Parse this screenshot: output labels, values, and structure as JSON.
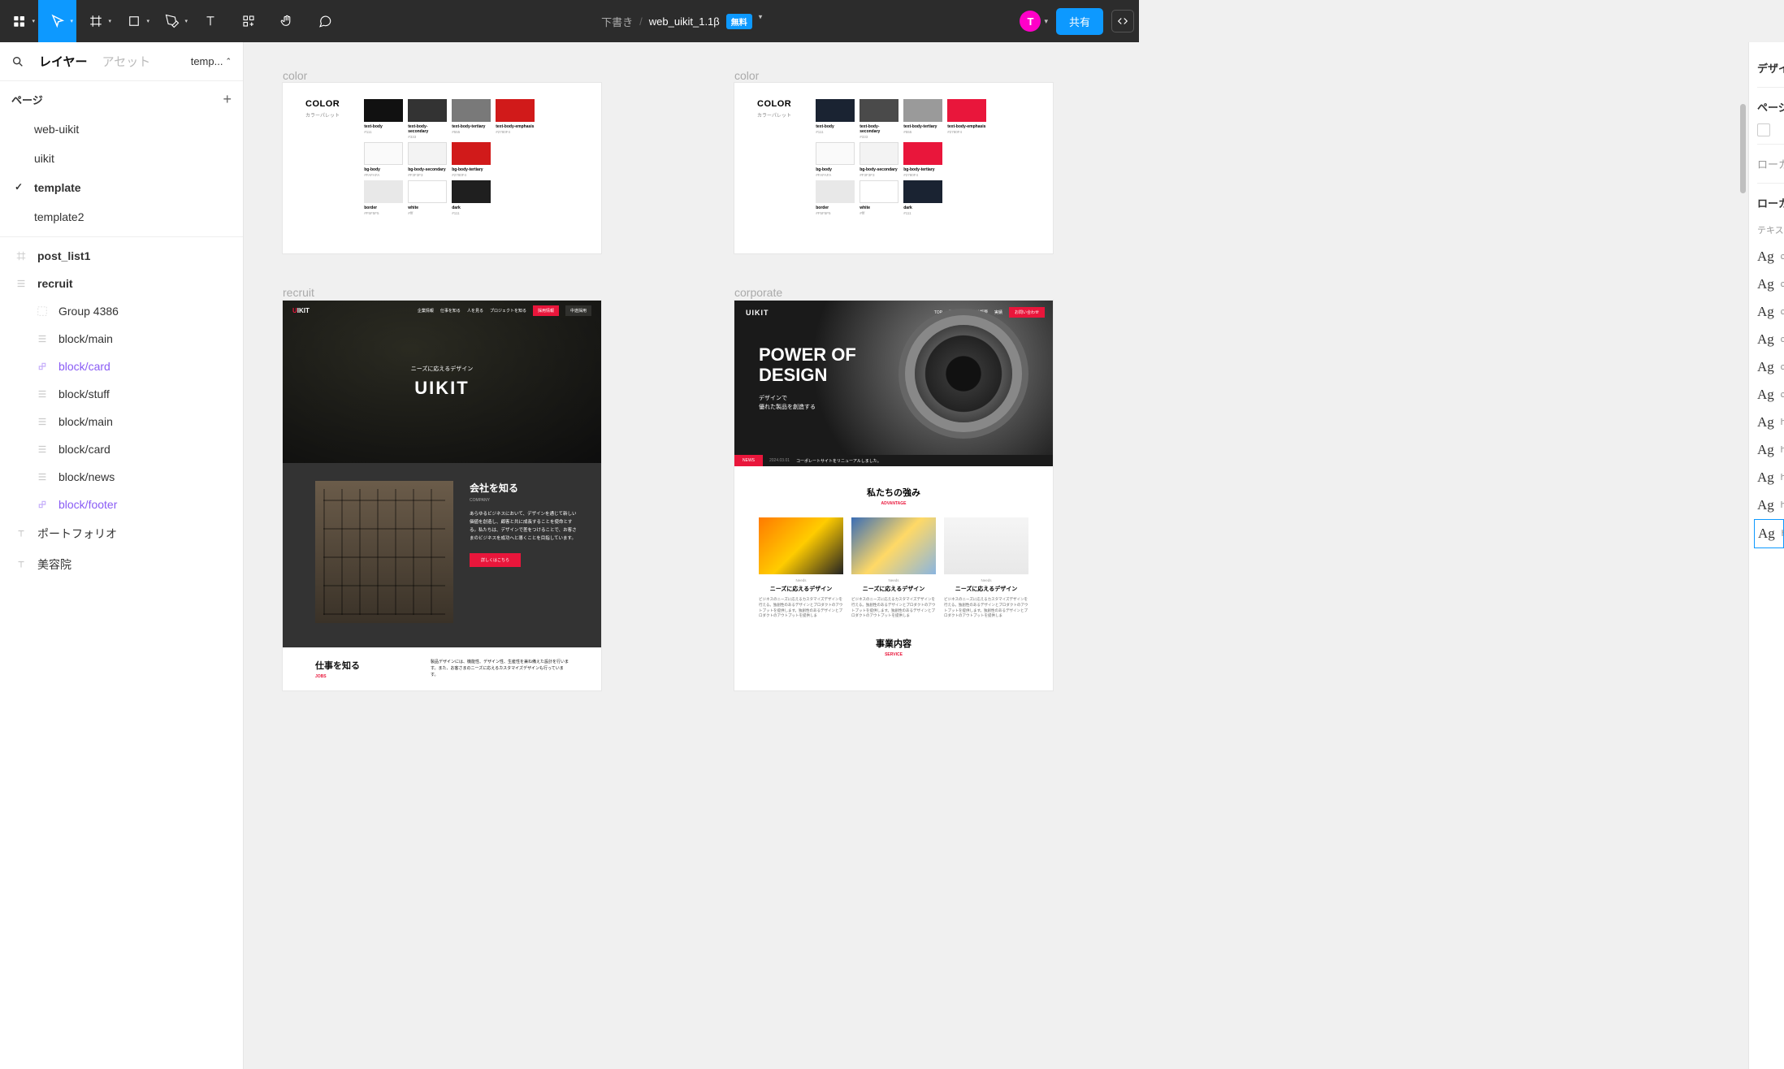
{
  "toolbar": {
    "title_draft": "下書き",
    "title_file": "web_uikit_1.1β",
    "badge_free": "無料",
    "share": "共有",
    "avatar": "T"
  },
  "left_panel": {
    "tab_layers": "レイヤー",
    "tab_assets": "アセット",
    "page_picker": "temp...",
    "pages_header": "ページ",
    "pages": [
      {
        "name": "web-uikit",
        "current": false
      },
      {
        "name": "uikit",
        "current": false
      },
      {
        "name": "template",
        "current": true
      },
      {
        "name": "template2",
        "current": false
      }
    ],
    "layers": [
      {
        "name": "post_list1",
        "icon": "frame",
        "level": 0,
        "bold": true
      },
      {
        "name": "recruit",
        "icon": "frame-lines",
        "level": 0,
        "bold": true
      },
      {
        "name": "Group 4386",
        "icon": "group",
        "level": 1
      },
      {
        "name": "block/main",
        "icon": "frame-lines",
        "level": 1
      },
      {
        "name": "block/card",
        "icon": "component",
        "level": 1,
        "comp": true
      },
      {
        "name": "block/stuff",
        "icon": "frame-lines",
        "level": 1
      },
      {
        "name": "block/main",
        "icon": "frame-lines",
        "level": 1
      },
      {
        "name": "block/card",
        "icon": "frame-lines",
        "level": 1
      },
      {
        "name": "block/news",
        "icon": "frame-lines",
        "level": 1
      },
      {
        "name": "block/footer",
        "icon": "component",
        "level": 1,
        "comp": true
      },
      {
        "name": "ポートフォリオ",
        "icon": "text",
        "level": 0
      },
      {
        "name": "美容院",
        "icon": "text",
        "level": 0
      }
    ]
  },
  "right_panel": {
    "design": "デザイ",
    "page": "ページ",
    "local": "ローカ",
    "local2": "ローカ",
    "text_styles": "テキス",
    "ag_items": [
      "Ag c",
      "Ag c",
      "Ag c",
      "Ag c",
      "Ag c",
      "Ag c",
      "Ag h",
      "Ag h",
      "Ag h",
      "Ag h",
      "Ag h"
    ]
  },
  "canvas": {
    "frames": {
      "color1": {
        "label": "color",
        "title": "COLOR",
        "subtitle": "カラーパレット",
        "swatches": [
          [
            {
              "color": "#111111",
              "name": "text-body",
              "hex": "#111"
            },
            {
              "color": "#333333",
              "name": "text-body-secondary",
              "hex": "#333"
            },
            {
              "color": "#797979",
              "name": "text-body-tertiary",
              "hex": "#555"
            },
            {
              "color": "#d11a1a",
              "name": "text-body-emphasis",
              "hex": "#2780F4"
            }
          ],
          [
            {
              "color": "#fafafa",
              "name": "bg-body",
              "hex": "#FAFAFA",
              "border": true
            },
            {
              "color": "#f3f3f3",
              "name": "bg-body-secondary",
              "hex": "#F3F3F3",
              "border": true
            },
            {
              "color": "#d11a1a",
              "name": "bg-body-tertiary",
              "hex": "#2780F4"
            }
          ],
          [
            {
              "color": "#e8e8e8",
              "name": "border",
              "hex": "#F5F5F5"
            },
            {
              "color": "#ffffff",
              "name": "white",
              "hex": "#fff",
              "border": true
            },
            {
              "color": "#1f1f1f",
              "name": "dark",
              "hex": "#111"
            }
          ]
        ]
      },
      "color2": {
        "label": "color",
        "title": "COLOR",
        "subtitle": "カラーパレット",
        "swatches": [
          [
            {
              "color": "#1a2332",
              "name": "text-body",
              "hex": "#111"
            },
            {
              "color": "#4a4a4a",
              "name": "text-body-secondary",
              "hex": "#333"
            },
            {
              "color": "#9a9a9a",
              "name": "text-body-tertiary",
              "hex": "#555"
            },
            {
              "color": "#e9163b",
              "name": "text-body-emphasis",
              "hex": "#2780F4"
            }
          ],
          [
            {
              "color": "#fafafa",
              "name": "bg-body",
              "hex": "#FAFAFA",
              "border": true
            },
            {
              "color": "#f3f3f3",
              "name": "bg-body-secondary",
              "hex": "#F3F3F3",
              "border": true
            },
            {
              "color": "#e9163b",
              "name": "bg-body-tertiary",
              "hex": "#2780F4"
            }
          ],
          [
            {
              "color": "#e8e8e8",
              "name": "border",
              "hex": "#F5F5F5"
            },
            {
              "color": "#ffffff",
              "name": "white",
              "hex": "#fff",
              "border": true
            },
            {
              "color": "#1a2332",
              "name": "dark",
              "hex": "#111"
            }
          ]
        ]
      },
      "recruit": {
        "label": "recruit",
        "logo": "IKIT",
        "nav": [
          "企業情報",
          "仕事を知る",
          "人を見る",
          "プロジェクトを知る"
        ],
        "nav_btn1": "採用情報",
        "nav_btn2": "中途採用",
        "hero_sub": "ニーズに応えるデザイン",
        "hero_title": "UIKIT",
        "company_h": "会社を知る",
        "company_en": "COMPANY",
        "company_p": "あらゆるビジネスにおいて、デザインを通じて新しい価値を創造し、顧客と共に成長することを使命とする。私たちは、デザインで差をつけることで、お客さまのビジネスを成功へと導くことを目指しています。",
        "company_cta": "詳しくはこちら",
        "jobs_h": "仕事を知る",
        "jobs_en": "JOBS",
        "jobs_p": "製品デザインには、機能性、デザイン性、生産性を兼ね備えた設計を行います。また、お客さまのニーズに応えるカスタマイズデザインも行っています。"
      },
      "corporate": {
        "label": "corporate",
        "logo": "UIKIT",
        "nav": [
          "TOP",
          "事業内容",
          "会社概要",
          "実績",
          "お問い合わせ"
        ],
        "hero_h1a": "POWER OF",
        "hero_h1b": "DESIGN",
        "hero_sub1": "デザインで",
        "hero_sub2": "優れた製品を創造する",
        "news_tag": "NEWS",
        "news_date": "2024.03.01",
        "news_text": "コーポレートサイトをリニューアルしました。",
        "adv_h": "私たちの強み",
        "adv_en": "ADVANTAGE",
        "cards": [
          {
            "sub": "Needs",
            "title": "ニーズに応えるデザイン",
            "desc": "ビジネスのニーズに応えるカスタマイズデザインを行える。独創性のあるデザインとプロダクトのアウトプットを提供します。独創性のあるデザインとプロダクトのアウトプットを提供しま"
          },
          {
            "sub": "Needs",
            "title": "ニーズに応えるデザイン",
            "desc": "ビジネスのニーズに応えるカスタマイズデザインを行える。独創性のあるデザインとプロダクトのアウトプットを提供します。独創性のあるデザインとプロダクトのアウトプットを提供しま"
          },
          {
            "sub": "Needs",
            "title": "ニーズに応えるデザイン",
            "desc": "ビジネスのニーズに応えるカスタマイズデザインを行える。独創性のあるデザインとプロダクトのアウトプットを提供します。独創性のあるデザインとプロダクトのアウトプットを提供しま"
          }
        ],
        "service_h": "事業内容",
        "service_en": "SERVICE"
      }
    }
  }
}
